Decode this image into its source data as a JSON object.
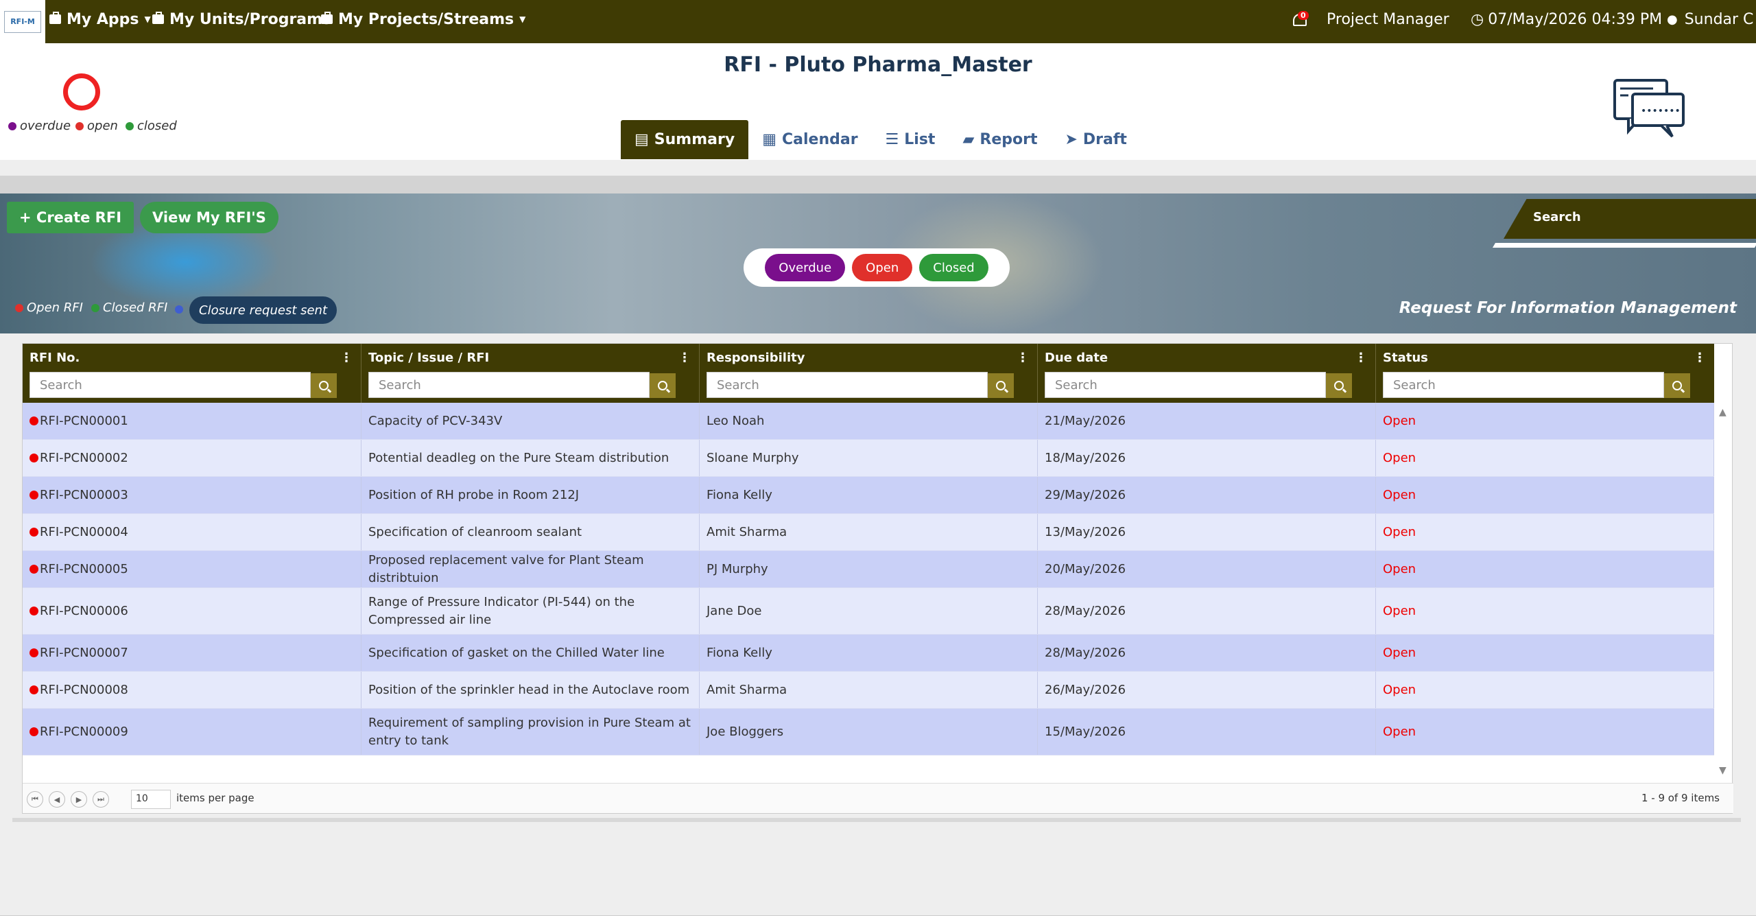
{
  "app": {
    "logo_text": "RFI-M"
  },
  "topnav": {
    "items": [
      {
        "label": "My Apps"
      },
      {
        "label": "My Units/Programs"
      },
      {
        "label": "My Projects/Streams"
      }
    ],
    "notifications": "0",
    "role": "Project Manager",
    "datetime": "07/May/2026 04:39 PM",
    "user": "Sundar C"
  },
  "header": {
    "title": "RFI - Pluto Pharma_Master",
    "legend": [
      "overdue",
      "open",
      "closed"
    ],
    "tabs": [
      {
        "label": "Summary",
        "icon": "summary-icon"
      },
      {
        "label": "Calendar",
        "icon": "calendar-icon"
      },
      {
        "label": "List",
        "icon": "list-icon"
      },
      {
        "label": "Report",
        "icon": "book-icon"
      },
      {
        "label": "Draft",
        "icon": "send-icon"
      }
    ]
  },
  "banner": {
    "create_label": "+ Create RFI",
    "view_label": "View My RFI'S",
    "search_label": "Search",
    "filters": [
      "Overdue",
      "Open",
      "Closed"
    ],
    "legend_open": "Open RFI",
    "legend_closed": "Closed RFI",
    "legend_closure": "Closure request sent",
    "heading": "Request For Information Management"
  },
  "colors": {
    "overdue": "#7a0f8c",
    "open": "#e0302b",
    "closed": "#2e9a3a",
    "closure": "#3f5ed0",
    "header_bg": "#3f3b04"
  },
  "grid": {
    "columns": [
      "RFI No.",
      "Topic / Issue / RFI",
      "Responsibility",
      "Due date",
      "Status"
    ],
    "search_placeholder": "Search",
    "rows": [
      {
        "no": "RFI-PCN00001",
        "topic": "Capacity of PCV-343V",
        "resp": "Leo Noah",
        "due": "21/May/2026",
        "status": "Open"
      },
      {
        "no": "RFI-PCN00002",
        "topic": "Potential deadleg on the Pure Steam distribution",
        "resp": "Sloane Murphy",
        "due": "18/May/2026",
        "status": "Open"
      },
      {
        "no": "RFI-PCN00003",
        "topic": "Position of RH probe in Room 212J",
        "resp": "Fiona Kelly",
        "due": "29/May/2026",
        "status": "Open"
      },
      {
        "no": "RFI-PCN00004",
        "topic": "Specification of cleanroom sealant",
        "resp": "Amit Sharma",
        "due": "13/May/2026",
        "status": "Open"
      },
      {
        "no": "RFI-PCN00005",
        "topic": "Proposed replacement valve for Plant Steam distribtuion",
        "resp": "PJ Murphy",
        "due": "20/May/2026",
        "status": "Open"
      },
      {
        "no": "RFI-PCN00006",
        "topic": "Range of Pressure Indicator (PI-544) on the Compressed air line",
        "resp": "Jane Doe",
        "due": "28/May/2026",
        "status": "Open"
      },
      {
        "no": "RFI-PCN00007",
        "topic": "Specification of gasket on the Chilled Water line",
        "resp": "Fiona Kelly",
        "due": "28/May/2026",
        "status": "Open"
      },
      {
        "no": "RFI-PCN00008",
        "topic": "Position of the sprinkler head in the Autoclave room",
        "resp": "Amit Sharma",
        "due": "26/May/2026",
        "status": "Open"
      },
      {
        "no": "RFI-PCN00009",
        "topic": "Requirement of sampling provision in Pure Steam at entry to tank",
        "resp": "Joe Bloggers",
        "due": "15/May/2026",
        "status": "Open"
      }
    ],
    "pager": {
      "page_size": "10",
      "per_page_label": "items per page",
      "info": "1 - 9 of 9 items"
    }
  }
}
